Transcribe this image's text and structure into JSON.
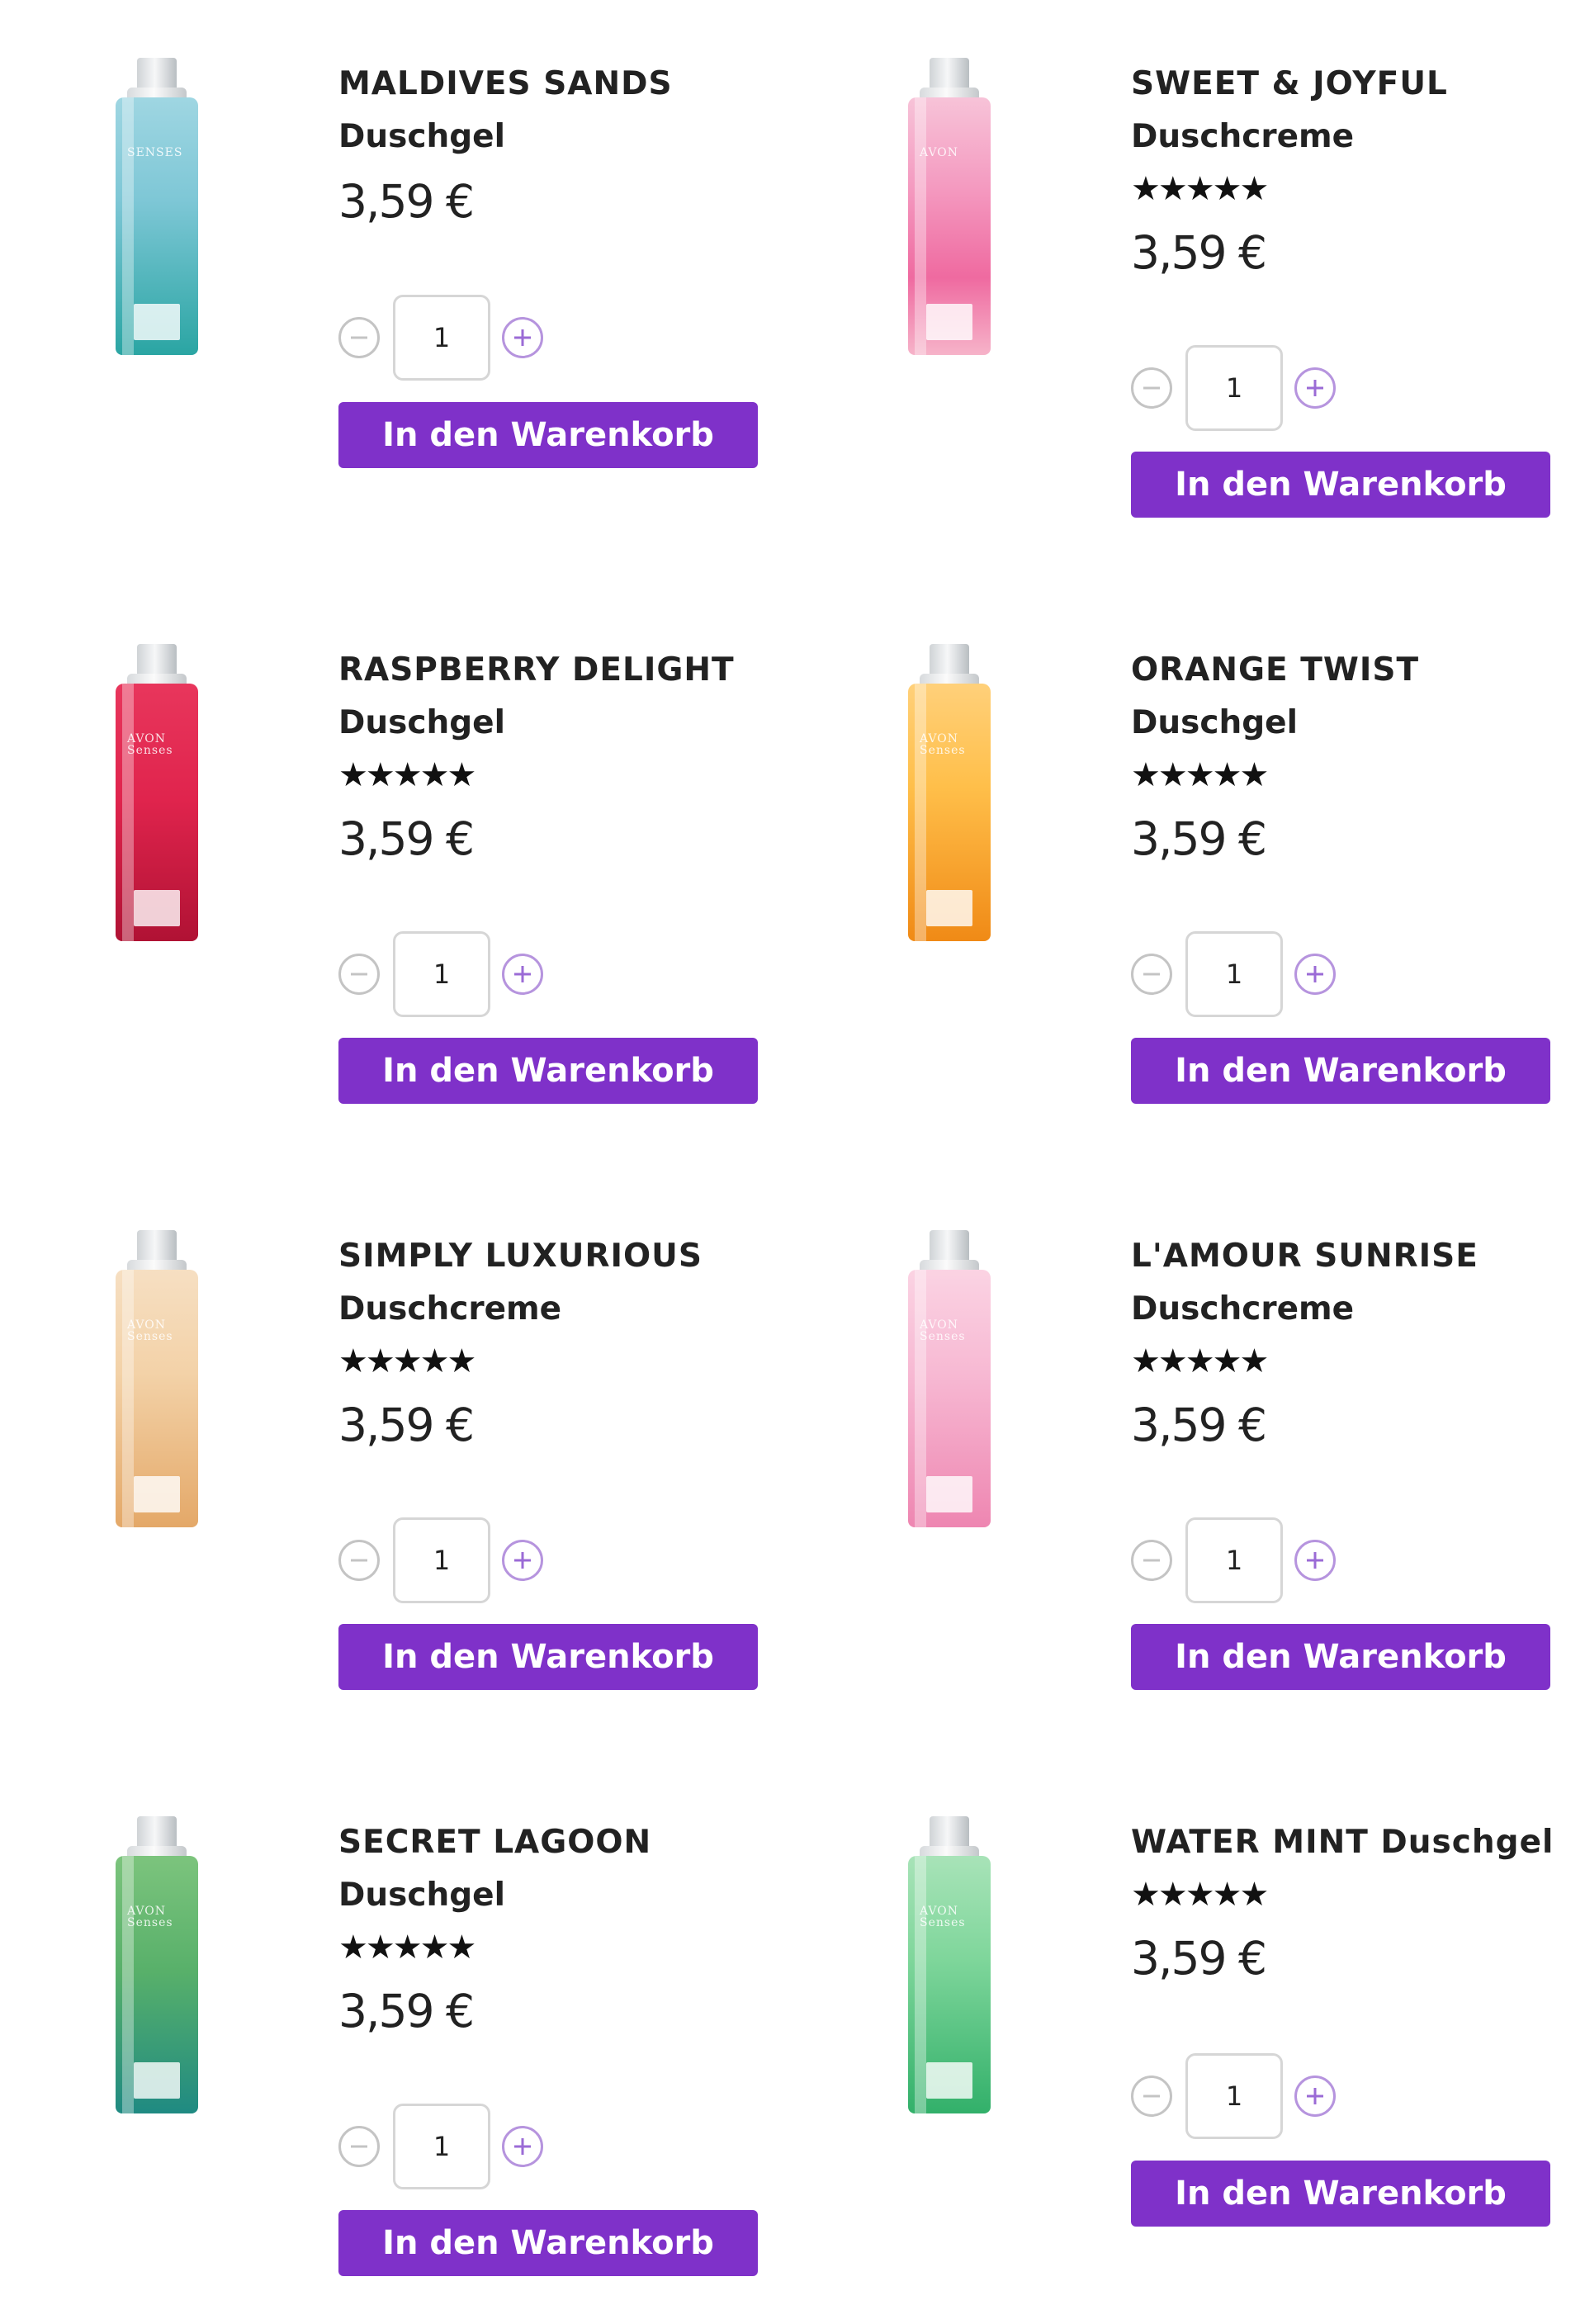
{
  "products": [
    {
      "name": "MALDIVES SANDS",
      "subtitle": "Duschgel",
      "rating": null,
      "stars": "",
      "price": "3,59 €",
      "quantity": "1",
      "cart_label": "In den Warenkorb",
      "bottle_colors": [
        "#7ec7d6",
        "#2aa5a3"
      ],
      "bottle_brand": "SENSES"
    },
    {
      "name": "SWEET & JOYFUL",
      "subtitle": "Duschcreme",
      "rating": 4.5,
      "stars": "★★★★★",
      "price": "3,59 €",
      "quantity": "1",
      "cart_label": "In den Warenkorb",
      "bottle_colors": [
        "#f49ac0",
        "#ef6aa0"
      ],
      "bottle_brand": "AVON"
    },
    {
      "name": "RASPBERRY DELIGHT",
      "subtitle": "Duschgel",
      "rating": 5,
      "stars": "★★★★★",
      "price": "3,59 €",
      "quantity": "1",
      "cart_label": "In den Warenkorb",
      "bottle_colors": [
        "#e0244d",
        "#b01234"
      ],
      "bottle_brand": "AVON Senses"
    },
    {
      "name": "ORANGE TWIST",
      "subtitle": "Duschgel",
      "rating": 4.5,
      "stars": "★★★★★",
      "price": "3,59 €",
      "quantity": "1",
      "cart_label": "In den Warenkorb",
      "bottle_colors": [
        "#ffbf4a",
        "#f08a16"
      ],
      "bottle_brand": "AVON Senses"
    },
    {
      "name": "SIMPLY LUXURIOUS",
      "subtitle": "Duschcreme",
      "rating": 5,
      "stars": "★★★★★",
      "price": "3,59 €",
      "quantity": "1",
      "cart_label": "In den Warenkorb",
      "bottle_colors": [
        "#f3d2a8",
        "#e4a868"
      ],
      "bottle_brand": "AVON Senses"
    },
    {
      "name": "L'AMOUR SUNRISE",
      "subtitle": "Duschcreme",
      "rating": 5,
      "stars": "★★★★★",
      "price": "3,59 €",
      "quantity": "1",
      "cart_label": "In den Warenkorb",
      "bottle_colors": [
        "#f7b9d3",
        "#ee86b1"
      ],
      "bottle_brand": "AVON Senses"
    },
    {
      "name": "SECRET LAGOON",
      "subtitle": "Duschgel",
      "rating": 5,
      "stars": "★★★★★",
      "price": "3,59 €",
      "quantity": "1",
      "cart_label": "In den Warenkorb",
      "bottle_colors": [
        "#58b06a",
        "#1f8a82"
      ],
      "bottle_brand": "AVON Senses"
    },
    {
      "name": "WATER MINT Duschgel",
      "subtitle": "",
      "rating": 5,
      "stars": "★★★★★",
      "price": "3,59 €",
      "quantity": "1",
      "cart_label": "In den Warenkorb",
      "bottle_colors": [
        "#7fd69b",
        "#32b06a"
      ],
      "bottle_brand": "AVON Senses"
    }
  ],
  "icons": {
    "minus": "minus-circle-icon",
    "plus": "plus-circle-icon"
  },
  "colors": {
    "accent": "#7f31c9",
    "text": "#222222"
  }
}
